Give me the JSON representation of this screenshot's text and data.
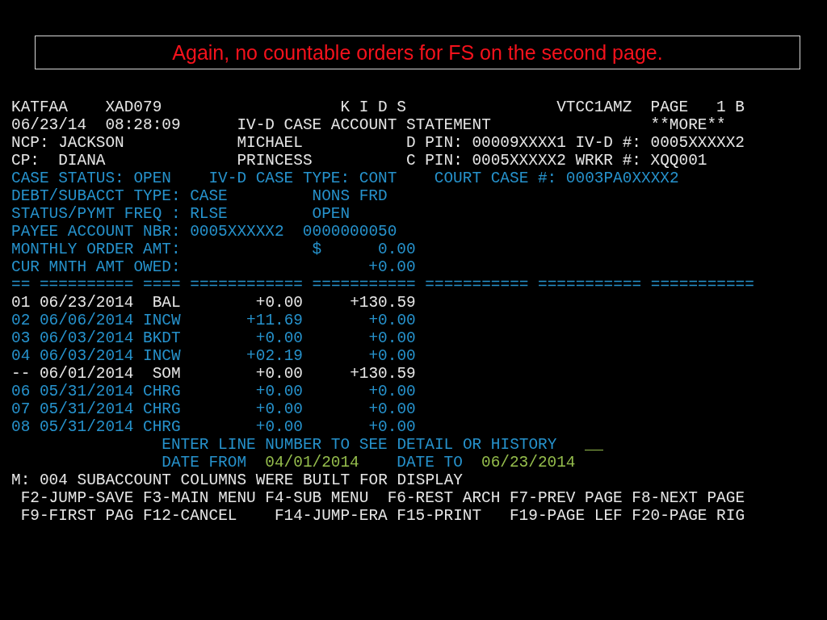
{
  "callout": {
    "text": "Again, no countable orders for FS on the second page."
  },
  "header_lines": [
    [
      {
        "text": "KATFAA",
        "kind": "text"
      },
      {
        "text": "XAD079",
        "kind": "text"
      },
      {
        "text": "K I D S",
        "kind": "text"
      },
      {
        "text": "VTCC1AMZ",
        "kind": "text"
      },
      {
        "text": "PAGE",
        "kind": "text"
      },
      {
        "text": "1 B",
        "kind": "text"
      }
    ],
    [
      {
        "text": "06/23/14",
        "kind": "text"
      },
      {
        "text": "08:28:09",
        "kind": "text"
      },
      {
        "text": "IV-D CASE ACCOUNT STATEMENT",
        "kind": "text"
      },
      {
        "text": "**MORE**",
        "kind": "text"
      }
    ],
    [
      {
        "text": "NCP:",
        "kind": "text"
      },
      {
        "text": "JACKSON",
        "kind": "text"
      },
      {
        "text": "MICHAEL",
        "kind": "text"
      },
      {
        "text": "D PIN:",
        "kind": "text"
      },
      {
        "text": "00009XXXX1",
        "kind": "text"
      },
      {
        "text": "IV-D #:",
        "kind": "text"
      },
      {
        "text": "0005XXXXX2",
        "kind": "text"
      }
    ],
    [
      {
        "text": "CP:",
        "kind": "text"
      },
      {
        "text": "DIANA",
        "kind": "text"
      },
      {
        "text": "PRINCESS",
        "kind": "text"
      },
      {
        "text": "C PIN:",
        "kind": "text"
      },
      {
        "text": "0005XXXXX2",
        "kind": "text"
      },
      {
        "text": "WRKR #:",
        "kind": "text"
      },
      {
        "text": "XQQ001",
        "kind": "text"
      }
    ],
    [
      {
        "text": "CASE STATUS: OPEN",
        "kind": "label"
      },
      {
        "text": "IV-D CASE TYPE: CONT",
        "kind": "label"
      },
      {
        "text": "COURT CASE #: 0003PA0XXXX2",
        "kind": "label"
      }
    ],
    [
      {
        "text": "DEBT/SUBACCT TYPE:",
        "kind": "label"
      },
      {
        "text": "CASE",
        "kind": "label"
      },
      {
        "text": "NONS FRD",
        "kind": "label"
      }
    ],
    [
      {
        "text": "STATUS/PYMT FREQ :",
        "kind": "label"
      },
      {
        "text": "RLSE",
        "kind": "label"
      },
      {
        "text": "OPEN",
        "kind": "label"
      }
    ],
    [
      {
        "text": "PAYEE ACCOUNT NBR:",
        "kind": "label"
      },
      {
        "text": "0005XXXXX2",
        "kind": "label"
      },
      {
        "text": "0000000050",
        "kind": "label"
      }
    ],
    [
      {
        "text": "MONTHLY ORDER AMT:",
        "kind": "label"
      },
      {
        "text": "$",
        "kind": "label"
      },
      {
        "text": "0.00",
        "kind": "label"
      }
    ],
    [
      {
        "text": "CUR MNTH AMT OWED:",
        "kind": "label"
      },
      {
        "text": "+0.00",
        "kind": "label"
      }
    ]
  ],
  "ledger": {
    "columns": [
      {
        "rule": "=="
      },
      {
        "rule": "=========="
      },
      {
        "rule": "===="
      },
      {
        "rule": "============"
      },
      {
        "rule": "==========="
      },
      {
        "rule": "==========="
      },
      {
        "rule": "==========="
      },
      {
        "rule": "==========="
      }
    ],
    "rows": [
      {
        "cells": [
          "01",
          "06/23/2014",
          "BAL",
          "+0.00",
          "+130.59"
        ],
        "highlighted": true
      },
      {
        "cells": [
          "02",
          "06/06/2014",
          "INCW",
          "+11.69",
          "+0.00"
        ],
        "highlighted": false
      },
      {
        "cells": [
          "03",
          "06/03/2014",
          "BKDT",
          "+0.00",
          "+0.00"
        ],
        "highlighted": false
      },
      {
        "cells": [
          "04",
          "06/03/2014",
          "INCW",
          "+02.19",
          "+0.00"
        ],
        "highlighted": false
      },
      {
        "cells": [
          "--",
          "06/01/2014",
          "SOM",
          "+0.00",
          "+130.59"
        ],
        "highlighted": true
      },
      {
        "cells": [
          "06",
          "05/31/2014",
          "CHRG",
          "+0.00",
          "+0.00"
        ],
        "highlighted": false
      },
      {
        "cells": [
          "07",
          "05/31/2014",
          "CHRG",
          "+0.00",
          "+0.00"
        ],
        "highlighted": false
      },
      {
        "cells": [
          "08",
          "05/31/2014",
          "CHRG",
          "+0.00",
          "+0.00"
        ],
        "highlighted": false
      }
    ]
  },
  "footer_lines": [
    [
      {
        "text": "ENTER LINE NUMBER TO SEE DETAIL OR HISTORY",
        "kind": "label"
      },
      {
        "kind": "input"
      }
    ],
    [
      {
        "text": "DATE FROM",
        "kind": "label"
      },
      {
        "text": "04/01/2014",
        "kind": "input"
      },
      {
        "text": "DATE TO",
        "kind": "label"
      },
      {
        "text": "06/23/2014",
        "kind": "input"
      }
    ],
    [
      {
        "text": "M: 004 SUBACCOUNT COLUMNS WERE BUILT FOR DISPLAY",
        "kind": "text"
      }
    ],
    [
      {
        "text": "F2-JUMP-SAVE",
        "kind": "text"
      },
      {
        "text": "F3-MAIN MENU",
        "kind": "text"
      },
      {
        "text": "F4-SUB MENU",
        "kind": "text"
      },
      {
        "text": "F6-REST ARCH",
        "kind": "text"
      },
      {
        "text": "F7-PREV PAGE",
        "kind": "text"
      },
      {
        "text": "F8-NEXT PAGE",
        "kind": "text"
      }
    ],
    [
      {
        "text": "F9-FIRST PAG",
        "kind": "text"
      },
      {
        "text": "F12-CANCEL",
        "kind": "text"
      },
      {
        "text": "F14-JUMP-ERA",
        "kind": "text"
      },
      {
        "text": "F15-PRINT",
        "kind": "text"
      },
      {
        "text": "F19-PAGE LEF",
        "kind": "text"
      },
      {
        "text": "F20-PAGE RIG",
        "kind": "text"
      }
    ]
  ]
}
